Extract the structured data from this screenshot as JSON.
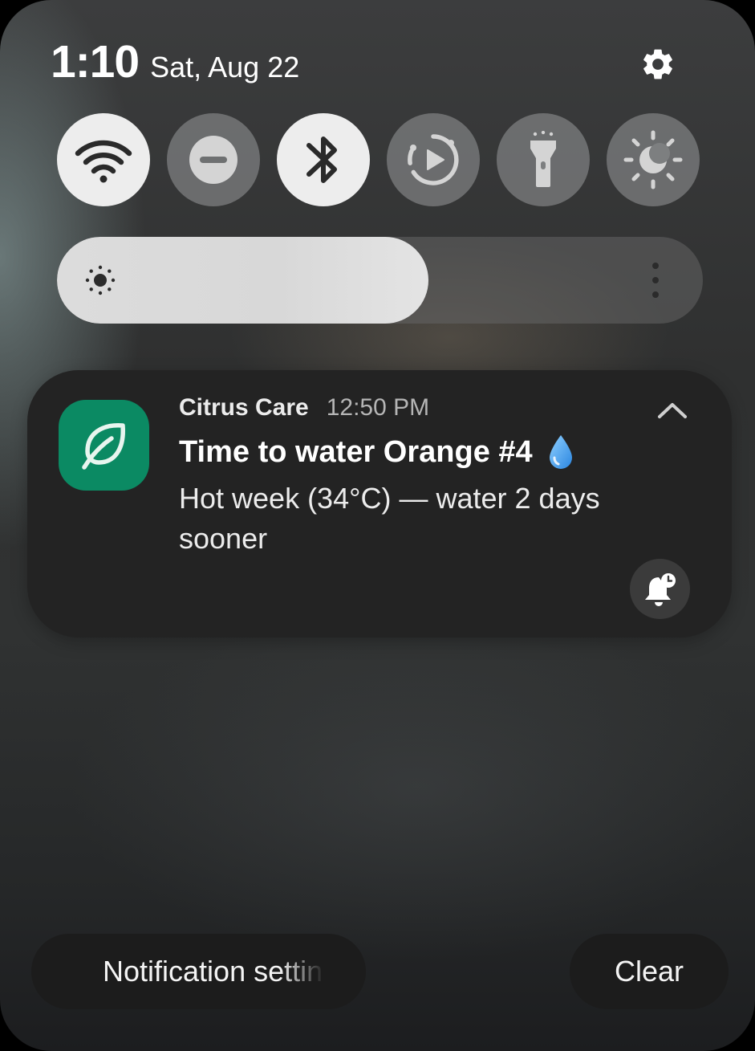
{
  "header": {
    "time": "1:10",
    "date": "Sat, Aug 22",
    "settings_icon": "gear-icon"
  },
  "quick_tiles": [
    {
      "name": "wifi",
      "icon": "wifi-icon",
      "active": true
    },
    {
      "name": "do-not-disturb",
      "icon": "do-not-disturb-icon",
      "active": false
    },
    {
      "name": "bluetooth",
      "icon": "bluetooth-icon",
      "active": true
    },
    {
      "name": "auto-rotate",
      "icon": "auto-rotate-icon",
      "active": false
    },
    {
      "name": "flashlight",
      "icon": "flashlight-icon",
      "active": false
    },
    {
      "name": "eye-comfort",
      "icon": "eye-comfort-icon",
      "active": false
    }
  ],
  "brightness": {
    "level": 0.575,
    "icon": "sun-icon",
    "more_icon": "more-vertical-icon"
  },
  "notification": {
    "app_name": "Citrus Care",
    "time": "12:50 PM",
    "title": "Time to water Orange #4",
    "body": "Hot week (34°C) — water 2 days sooner",
    "app_icon": "leaf-icon",
    "title_icon": "water-drop-icon",
    "collapse_icon": "chevron-up-icon",
    "snooze_icon": "bell-snooze-icon",
    "app_color": "#0b8a63"
  },
  "footer": {
    "settings_label": "Notification settings",
    "clear_label": "Clear"
  },
  "colors": {
    "tile_on": "#ededed",
    "tile_off": "#7d7f80",
    "card_bg": "#232323",
    "drop_blue": "#4da3ee"
  }
}
